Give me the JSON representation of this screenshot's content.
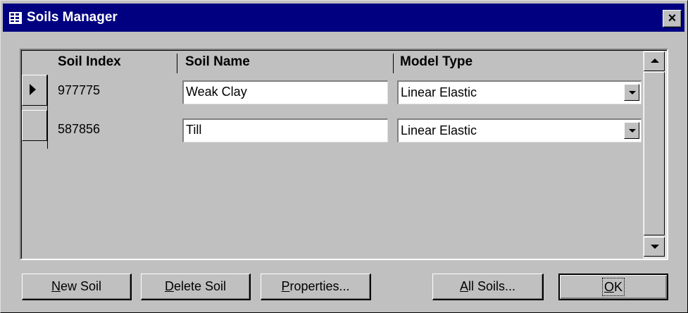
{
  "window": {
    "title": "Soils Manager",
    "close_glyph": "×"
  },
  "grid": {
    "columns": [
      "Soil Index",
      "Soil Name",
      "Model Type"
    ],
    "rows": [
      {
        "index": "977775",
        "name": "Weak Clay",
        "model": "Linear Elastic",
        "selected": true
      },
      {
        "index": "587856",
        "name": "Till",
        "model": "Linear Elastic",
        "selected": false
      }
    ]
  },
  "buttons": {
    "new_soil": {
      "mnemonic": "N",
      "rest": "ew Soil"
    },
    "delete_soil": {
      "mnemonic": "D",
      "rest": "elete Soil"
    },
    "properties": {
      "mnemonic": "P",
      "rest": "roperties..."
    },
    "all_soils": {
      "mnemonic": "A",
      "rest": "ll Soils..."
    },
    "ok": {
      "mnemonic": "O",
      "rest": "K"
    }
  },
  "icons": {
    "title": "form-icon",
    "row_pointer": "record-selector-arrow-icon",
    "dropdown": "chevron-down-icon",
    "scroll_up": "scroll-up-icon",
    "scroll_down": "scroll-down-icon"
  },
  "colors": {
    "titlebar": "#000080",
    "face": "#c0c0c0"
  }
}
